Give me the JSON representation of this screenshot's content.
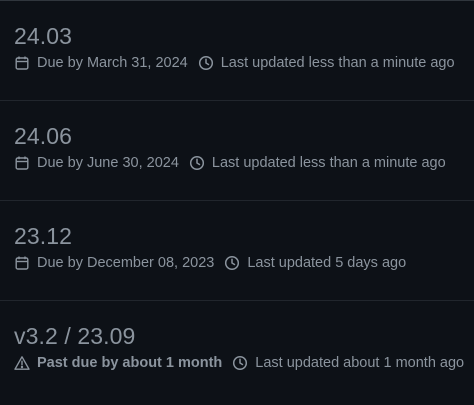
{
  "milestones": [
    {
      "title": "24.03",
      "due_icon": "calendar-icon",
      "due_text": "Due by March 31, 2024",
      "updated_icon": "clock-icon",
      "updated_text": "Last updated less than a minute ago"
    },
    {
      "title": "24.06",
      "due_icon": "calendar-icon",
      "due_text": "Due by June 30, 2024",
      "updated_icon": "clock-icon",
      "updated_text": "Last updated less than a minute ago"
    },
    {
      "title": "23.12",
      "due_icon": "calendar-icon",
      "due_text": "Due by December 08, 2023",
      "updated_icon": "clock-icon",
      "updated_text": "Last updated 5 days ago"
    },
    {
      "title": "v3.2 / 23.09",
      "due_icon": "alert-icon",
      "due_text": "Past due by about 1 month",
      "updated_icon": "clock-icon",
      "updated_text": "Last updated about 1 month ago"
    }
  ],
  "colors": {
    "background": "#0d1117",
    "text": "#8b949e",
    "divider": "#21262d"
  }
}
